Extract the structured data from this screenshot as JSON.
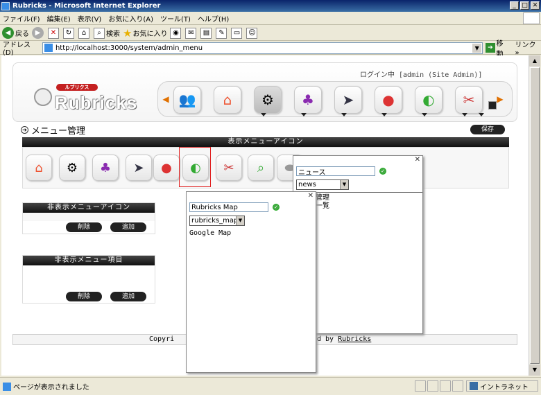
{
  "window": {
    "title": "Rubricks - Microsoft Internet Explorer",
    "controls": [
      "_",
      "□",
      "✕"
    ]
  },
  "menubar": [
    "ファイル(F)",
    "編集(E)",
    "表示(V)",
    "お気に入り(A)",
    "ツール(T)",
    "ヘルプ(H)"
  ],
  "toolbar": {
    "back_label": "戻る",
    "search_label": "検索",
    "favorites_label": "お気に入り"
  },
  "address": {
    "label": "アドレス(D)",
    "url": "http://localhost:3000/system/admin_menu",
    "go_label": "移動",
    "links_label": "リンク »"
  },
  "header": {
    "logo_katakana": "ルブリクス",
    "logo_text": "Rubricks",
    "login_status": "ログイン中 [admin (Site Admin)]",
    "nav_icons": [
      "people",
      "home",
      "settings",
      "hierarchy",
      "fish",
      "apple",
      "map",
      "photo"
    ]
  },
  "page": {
    "title": "メニュー管理",
    "save_label": "保存",
    "visible_section_title": "表示メニューアイコン",
    "visible_icons": [
      "home",
      "settings",
      "hierarchy",
      "fish",
      "apple",
      "map",
      "photo",
      "search",
      "stone"
    ],
    "hidden_icons_title": "非表示メニューアイコン",
    "hidden_items_title": "非表示メニュー項目",
    "delete_label": "削除",
    "add_label": "追加",
    "footer_left": "Copyri",
    "footer_right_prefix": "d by",
    "footer_link": "Rubricks"
  },
  "popup_news": {
    "close": "✕",
    "name_value": "ニュース",
    "select_value": "news",
    "list_items": [
      "ス管理",
      "ス一覧"
    ]
  },
  "popup_map": {
    "close": "✕",
    "name_value": "Rubricks Map",
    "select_value": "rubricks_map",
    "list_items": [
      "Google Map"
    ]
  },
  "statusbar": {
    "text": "ページが表示されました",
    "zone": "イントラネット"
  }
}
